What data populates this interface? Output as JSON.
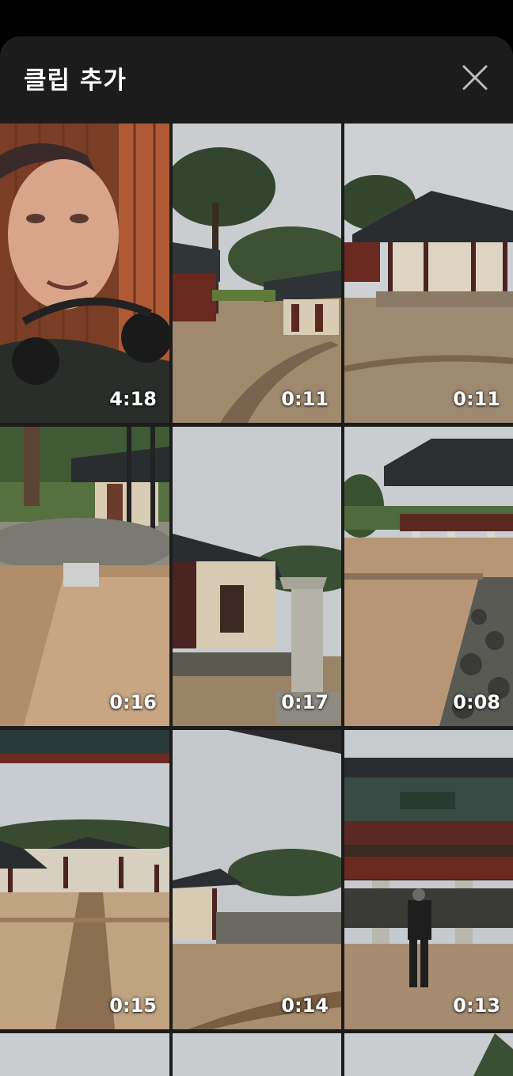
{
  "header": {
    "title": "클립 추가",
    "close_icon": "close-icon"
  },
  "clips": [
    {
      "duration": "4:18",
      "subject": "person-selfie"
    },
    {
      "duration": "0:11",
      "subject": "hanok-pine-path"
    },
    {
      "duration": "0:11",
      "subject": "hanok-pavilion"
    },
    {
      "duration": "0:16",
      "subject": "burial-mound-stone"
    },
    {
      "duration": "0:17",
      "subject": "stone-marker-hanok"
    },
    {
      "duration": "0:08",
      "subject": "gate-pavilion"
    },
    {
      "duration": "0:15",
      "subject": "courtyard-path"
    },
    {
      "duration": "0:14",
      "subject": "wall-trees"
    },
    {
      "duration": "0:13",
      "subject": "gate-with-person"
    }
  ],
  "colors": {
    "background": "#000000",
    "sheet": "#1c1c1c",
    "text": "#ffffff"
  }
}
